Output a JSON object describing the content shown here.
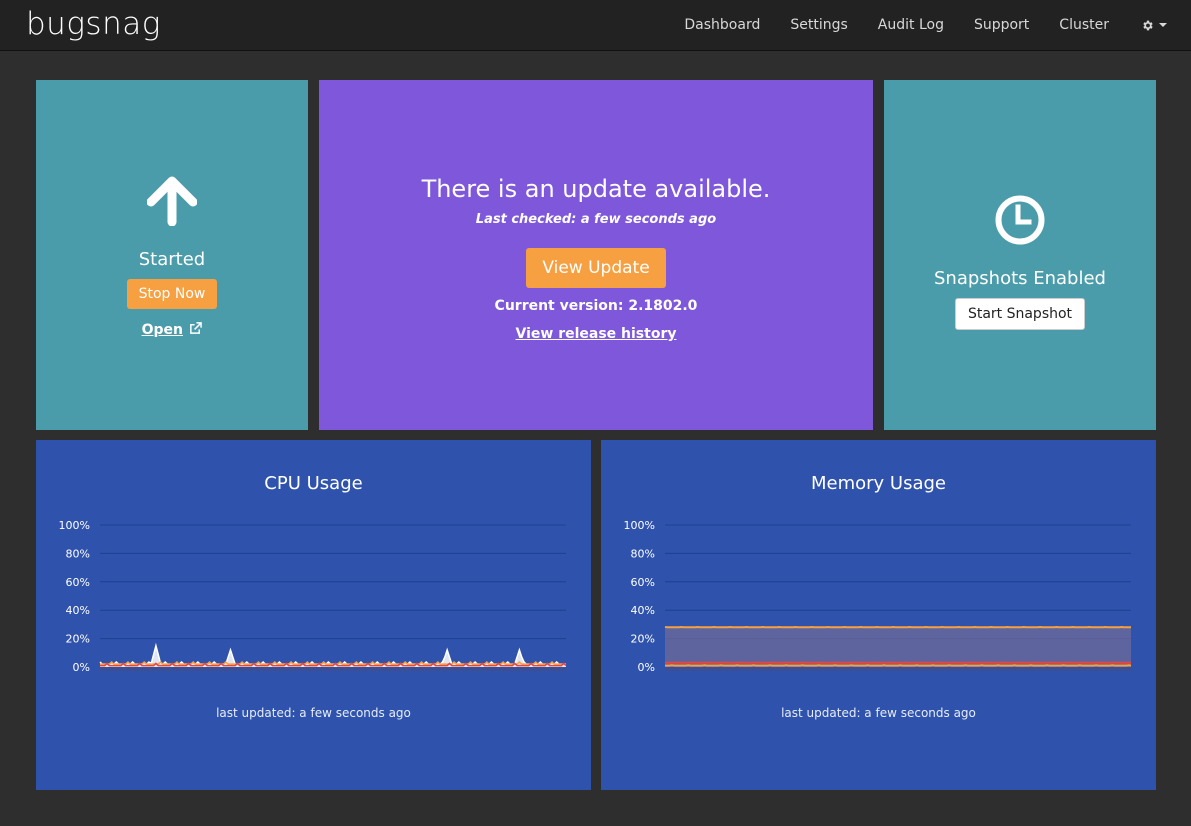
{
  "nav": {
    "brand": "bugsnag",
    "links": [
      "Dashboard",
      "Settings",
      "Audit Log",
      "Support",
      "Cluster"
    ],
    "gear_icon": "gear-icon"
  },
  "status_tile": {
    "icon": "arrow-up-icon",
    "title": "Started",
    "stop_label": "Stop Now",
    "open_label": "Open",
    "open_icon": "external-link-icon"
  },
  "update_tile": {
    "title": "There is an update available.",
    "last_checked": "Last checked: a few seconds ago",
    "view_update_label": "View Update",
    "current_version": "Current version: 2.1802.0",
    "release_history_label": "View release history"
  },
  "snapshot_tile": {
    "icon": "clock-icon",
    "title": "Snapshots Enabled",
    "start_label": "Start Snapshot"
  },
  "colors": {
    "teal": "#4a9caa",
    "purple": "#7e57db",
    "blue": "#2f53ac",
    "orange": "#f6a042",
    "navbar": "#222222"
  },
  "chart_data": [
    {
      "type": "area",
      "title": "CPU Usage",
      "footer": "last updated: a few seconds ago",
      "ylim": [
        0,
        100
      ],
      "y_ticks": [
        "100%",
        "80%",
        "60%",
        "40%",
        "20%",
        "0%"
      ],
      "grid": true,
      "series": [
        {
          "color": "#ffffff",
          "baseline": 2,
          "spikes": [
            [
              0.12,
              15
            ],
            [
              0.28,
              12
            ],
            [
              0.745,
              12
            ],
            [
              0.9,
              12
            ]
          ]
        },
        {
          "color": "#f6a042",
          "baseline": 2
        },
        {
          "color": "#e8453c",
          "baseline": 1
        }
      ]
    },
    {
      "type": "area",
      "title": "Memory Usage",
      "footer": "last updated: a few seconds ago",
      "ylim": [
        0,
        100
      ],
      "y_ticks": [
        "100%",
        "80%",
        "60%",
        "40%",
        "20%",
        "0%"
      ],
      "grid": true,
      "series": [
        {
          "color": "#f6a042",
          "baseline": 28
        },
        {
          "color": "#e8453c",
          "baseline": 3
        },
        {
          "color": "#f6a042",
          "baseline": 1
        }
      ]
    }
  ]
}
